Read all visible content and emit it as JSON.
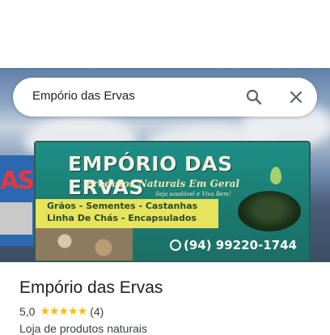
{
  "search": {
    "query": "Empório das Ervas"
  },
  "icons": {
    "search": "search-icon",
    "close": "close-icon",
    "star": "star-icon",
    "whatsapp": "whatsapp-icon"
  },
  "photo": {
    "sign_left_text": "AS",
    "sign_title": "EMPÓRIO DAS ERVAS",
    "sign_subtitle": "Produtos Naturais Em Geral",
    "sign_slogan": "Seja saudável e Viva Bem!",
    "sign_line1": "Grãos - Sementes - Castanhas",
    "sign_line2": "Linha De Chás - Encapsulados",
    "sign_phone": "(94) 99220-1744"
  },
  "place": {
    "name": "Empório das Ervas",
    "rating": "5,0",
    "stars": "★★★★★",
    "reviews": "(4)",
    "category": "Loja de produtos naturais"
  },
  "colors": {
    "star": "#fbbc04",
    "text_primary": "#202124",
    "text_secondary": "#3c4043"
  }
}
